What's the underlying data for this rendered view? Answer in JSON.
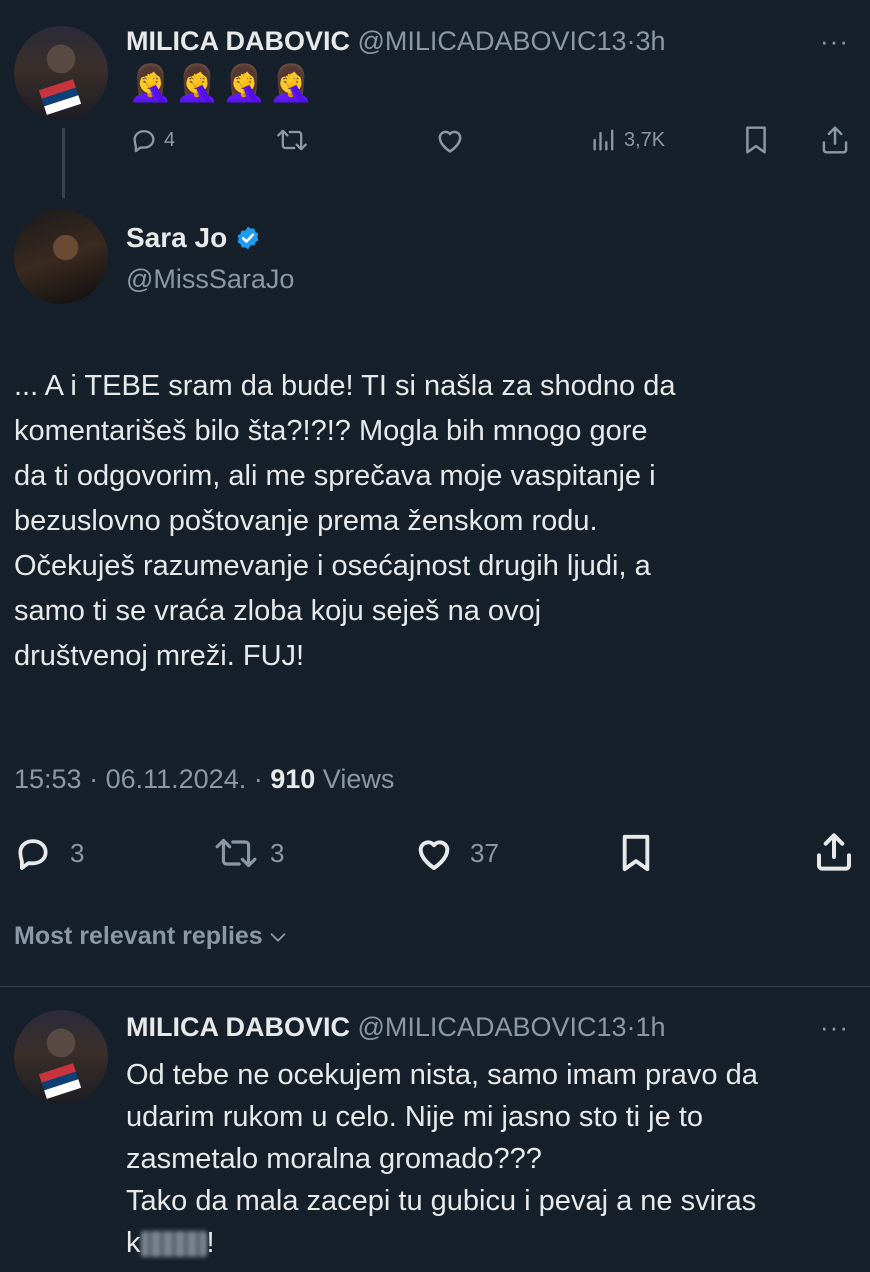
{
  "tweet1": {
    "display_name": "MILICA DABOVIC",
    "handle": "@MILICADABOVIC13",
    "dot": "·",
    "time": "3h",
    "more": "···",
    "emojis": [
      "🤦‍♀️",
      "🤦‍♀️",
      "🤦‍♀️",
      "🤦‍♀️"
    ],
    "reply_count": "4",
    "views": "3,7K"
  },
  "tweet2": {
    "display_name": "Sara Jo",
    "handle": "@MissSaraJo",
    "body": [
      "... A i TEBE sram da bude! TI si našla za shodno da",
      "komentarišeš bilo šta?!?!? Mogla bih mnogo gore",
      "da ti odgovorim, ali me sprečava moje vaspitanje i",
      "bezuslovno poštovanje prema ženskom rodu.",
      "Očekuješ razumevanje i osećajnost drugih ljudi, a",
      "samo ti se vraća zloba koju seješ na ovoj",
      "društvenoj mreži. FUJ!"
    ],
    "time": "15:53",
    "date": "06.11.2024.",
    "views_count": "910",
    "views_label": "Views",
    "reply_count": "3",
    "retweet_count": "3",
    "like_count": "37"
  },
  "replies_header": "Most relevant replies",
  "tweet3": {
    "display_name": "MILICA DABOVIC",
    "handle": "@MILICADABOVIC13",
    "dot": "·",
    "time": "1h",
    "more": "···",
    "body": [
      "Od tebe ne ocekujem nista, samo imam pravo da",
      "udarim rukom u celo. Nije mi jasno sto ti je to",
      "zasmetalo moralna gromado???",
      "Tako da mala zacepi tu gubicu i pevaj a ne sviras"
    ],
    "last_line_start": "k",
    "last_line_end": "!"
  },
  "colors": {
    "background": "#15202b",
    "text": "#e7e9ea",
    "muted": "#8b98a5",
    "verified": "#1d9bf0"
  }
}
